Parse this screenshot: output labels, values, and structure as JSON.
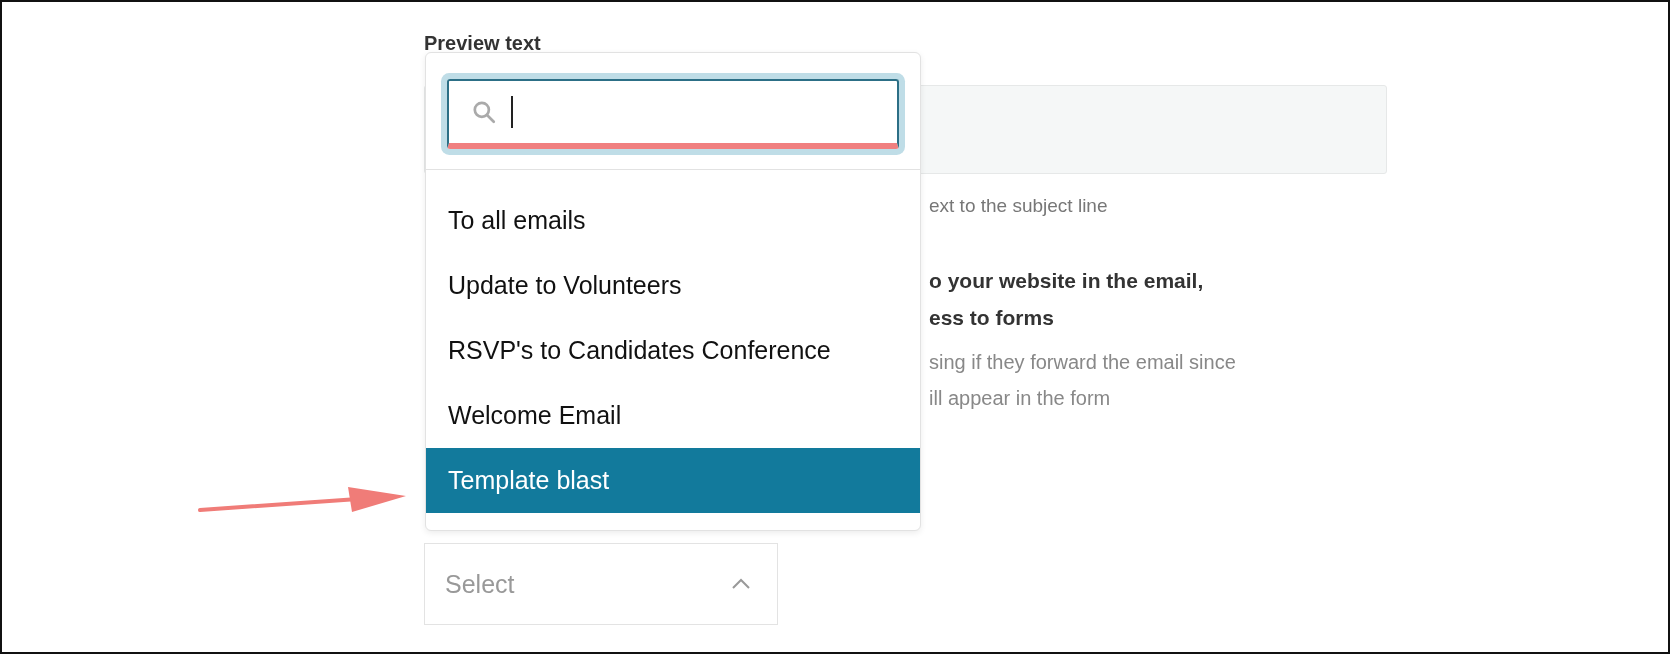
{
  "preview_text": {
    "label": "Preview text",
    "hint": "ext to the subject line"
  },
  "link_option": {
    "title_lines": [
      "o your website in the email,",
      "ess to forms"
    ],
    "description_lines": [
      "sing if they forward the email since",
      "ill appear in the form"
    ]
  },
  "dropdown": {
    "open": true,
    "options": [
      {
        "label": "To all emails",
        "selected": false
      },
      {
        "label": "Update to Volunteers",
        "selected": false
      },
      {
        "label": "RSVP's to Candidates Conference",
        "selected": false
      },
      {
        "label": "Welcome Email",
        "selected": false
      },
      {
        "label": "Template blast",
        "selected": true
      }
    ]
  },
  "select": {
    "placeholder": "Select",
    "expanded": true
  }
}
